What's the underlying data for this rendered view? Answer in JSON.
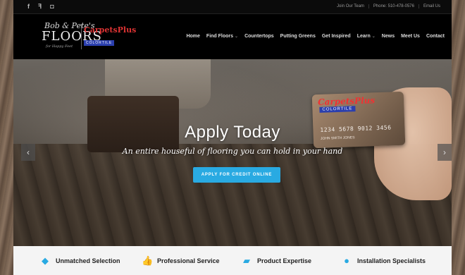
{
  "topbar": {
    "social": [
      "f",
      "ꟻ",
      "◘"
    ],
    "links": [
      "Join Our Team",
      "Phone: 510-478-0576",
      "Email Us"
    ]
  },
  "logo": {
    "script": "Bob & Pete's",
    "main": "FLOORS",
    "tagline": "for Happy Feet",
    "partner": "CarpetsPlus",
    "partner_sub": "COLORTILE"
  },
  "nav": {
    "items": [
      {
        "label": "Home",
        "active": true,
        "dropdown": false
      },
      {
        "label": "Find Floors",
        "active": false,
        "dropdown": true
      },
      {
        "label": "Countertops",
        "active": false,
        "dropdown": false
      },
      {
        "label": "Putting Greens",
        "active": false,
        "dropdown": false
      },
      {
        "label": "Get Inspired",
        "active": false,
        "dropdown": false
      },
      {
        "label": "Learn",
        "active": false,
        "dropdown": true
      },
      {
        "label": "News",
        "active": false,
        "dropdown": false
      },
      {
        "label": "Meet Us",
        "active": false,
        "dropdown": false
      },
      {
        "label": "Contact",
        "active": false,
        "dropdown": false
      }
    ]
  },
  "hero": {
    "title": "Apply Today",
    "subtitle": "An entire houseful of flooring you can hold in your hand",
    "button": "APPLY FOR CREDIT ONLINE",
    "card": {
      "brand": "CarpetsPlus",
      "sub": "COLORTILE",
      "number": "1234 5678 9012 3456",
      "name": "JOHN SMITH JONES"
    }
  },
  "features": [
    {
      "icon": "tag-icon",
      "glyph": "◆",
      "label": "Unmatched Selection"
    },
    {
      "icon": "thumbs-up-icon",
      "glyph": "👍",
      "label": "Professional Service"
    },
    {
      "icon": "book-icon",
      "glyph": "▰",
      "label": "Product Expertise"
    },
    {
      "icon": "user-icon",
      "glyph": "●",
      "label": "Installation Specialists"
    }
  ],
  "colors": {
    "accent": "#29aae2",
    "nav_active": "#3aa3e3"
  }
}
